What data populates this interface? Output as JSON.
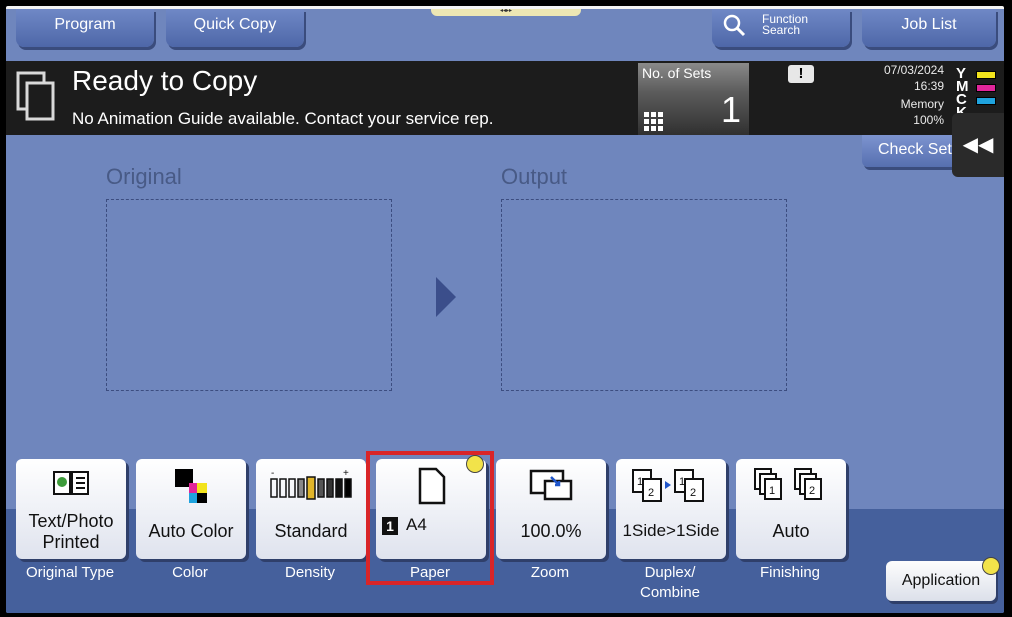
{
  "topbar": {
    "program": "Program",
    "quick_copy": "Quick Copy",
    "function_search_line1": "Function",
    "function_search_line2": "Search",
    "job_list": "Job List"
  },
  "status": {
    "title": "Ready to Copy",
    "message": "No Animation Guide available. Contact your service rep."
  },
  "sets": {
    "label": "No. of Sets",
    "value": "1"
  },
  "info": {
    "date": "07/03/2024",
    "time": "16:39",
    "memory_label": "Memory",
    "memory_value": "100%"
  },
  "toner": [
    {
      "letter": "Y",
      "color": "#f2e31c"
    },
    {
      "letter": "M",
      "color": "#e2269b"
    },
    {
      "letter": "C",
      "color": "#1fa3de"
    },
    {
      "letter": "K",
      "color": "#111111"
    }
  ],
  "check_settings": "Check Settings",
  "areas": {
    "original": "Original",
    "output": "Output"
  },
  "functions": [
    {
      "value_line1": "Text/Photo",
      "value_line2": "Printed",
      "label_line1": "Original Type",
      "label_line2": ""
    },
    {
      "value_line1": "Auto Color",
      "value_line2": "",
      "label_line1": "Color",
      "label_line2": ""
    },
    {
      "value_line1": "Standard",
      "value_line2": "",
      "label_line1": "Density",
      "label_line2": ""
    },
    {
      "value_line1": "A4",
      "value_line2": "",
      "tray": "1",
      "label_line1": "Paper",
      "label_line2": ""
    },
    {
      "value_line1": "100.0%",
      "value_line2": "",
      "label_line1": "Zoom",
      "label_line2": ""
    },
    {
      "value_line1": "1Side>1Side",
      "value_line2": "",
      "label_line1": "Duplex/",
      "label_line2": "Combine"
    },
    {
      "value_line1": "Auto",
      "value_line2": "",
      "label_line1": "Finishing",
      "label_line2": ""
    }
  ],
  "application": "Application",
  "colors": {
    "panel": "#6f86bd",
    "button": "#5a73b4",
    "highlight": "#d92528"
  }
}
